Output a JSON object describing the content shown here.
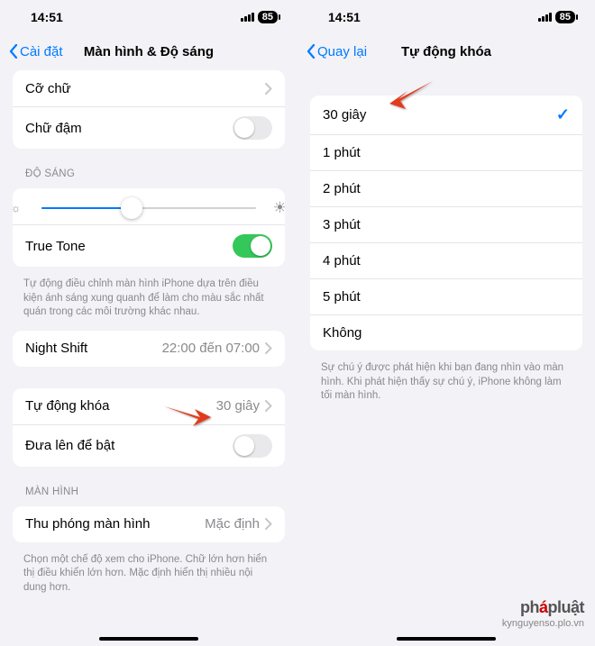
{
  "status": {
    "time": "14:51",
    "battery": "85"
  },
  "left": {
    "back": "Cài đặt",
    "title": "Màn hình & Độ sáng",
    "text_size": "Cỡ chữ",
    "bold_text": "Chữ đậm",
    "brightness_header": "ĐỘ SÁNG",
    "true_tone": "True Tone",
    "true_tone_footer": "Tự động điều chỉnh màn hình iPhone dựa trên điều kiện ánh sáng xung quanh để làm cho màu sắc nhất quán trong các môi trường khác nhau.",
    "night_shift": "Night Shift",
    "night_shift_value": "22:00 đến 07:00",
    "auto_lock": "Tự động khóa",
    "auto_lock_value": "30 giây",
    "raise_to_wake": "Đưa lên để bật",
    "display_header": "MÀN HÌNH",
    "display_zoom": "Thu phóng màn hình",
    "display_zoom_value": "Mặc định",
    "display_zoom_footer": "Chọn một chế độ xem cho iPhone. Chữ lớn hơn hiển thị điều khiển lớn hơn. Mặc định hiển thị nhiều nội dung hơn."
  },
  "right": {
    "back": "Quay lại",
    "title": "Tự động khóa",
    "options": {
      "o0": "30 giây",
      "o1": "1 phút",
      "o2": "2 phút",
      "o3": "3 phút",
      "o4": "4 phút",
      "o5": "5 phút",
      "o6": "Không"
    },
    "footer": "Sự chú ý được phát hiện khi bạn đang nhìn vào màn hình. Khi phát hiện thấy sự chú ý, iPhone không làm tối màn hình."
  },
  "watermark": {
    "brand_pre": "ph",
    "brand_mid": "á",
    "brand_post": "pluật",
    "sub": "kynguyenso.plo.vn"
  }
}
